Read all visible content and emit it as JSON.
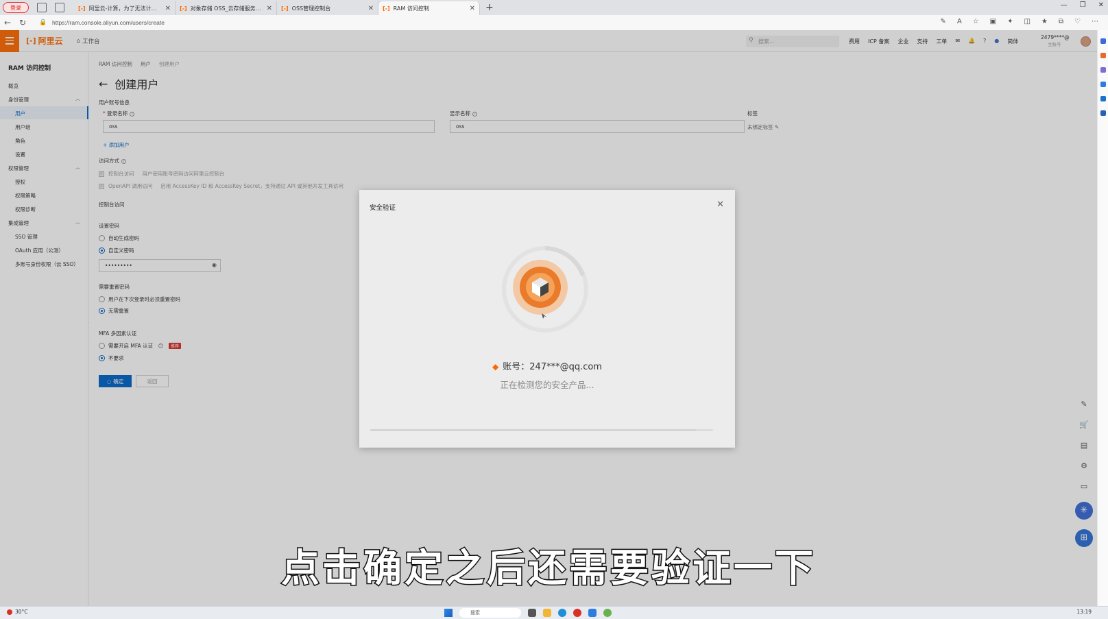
{
  "browser": {
    "profile_label": "登录",
    "tabs": [
      {
        "title": "阿里云-计算，为了无法计算的价",
        "active": false
      },
      {
        "title": "对象存储 OSS_云存储服务_企业",
        "active": false
      },
      {
        "title": "OSS管理控制台",
        "active": false
      },
      {
        "title": "RAM 访问控制",
        "active": true
      }
    ],
    "url": "https://ram.console.aliyun.com/users/create"
  },
  "console_header": {
    "logo_text": "阿里云",
    "workbench_label": "工作台",
    "search_placeholder": "搜索...",
    "links": [
      "费用",
      "ICP 备案",
      "企业",
      "支持",
      "工单",
      "✉",
      "🔔",
      "?",
      "●",
      "简体"
    ],
    "account_id": "2479****@",
    "account_sub": "主账号"
  },
  "sidebar": {
    "title": "RAM 访问控制",
    "overview": "概览",
    "groups": [
      {
        "label": "身份管理",
        "items": [
          "用户",
          "用户组",
          "角色",
          "设置"
        ]
      },
      {
        "label": "权限管理",
        "items": [
          "授权",
          "权限策略",
          "权限诊断"
        ]
      },
      {
        "label": "集成管理",
        "items": [
          "SSO 管理",
          "OAuth 应用（公测）",
          "多账号身份权限（云 SSO）"
        ]
      }
    ],
    "active_item": "用户"
  },
  "page": {
    "breadcrumb": [
      "RAM 访问控制",
      "用户",
      "创建用户"
    ],
    "title": "创建用户",
    "section_account_info": "用户账号信息",
    "login_name_label": "登录名称",
    "login_name_value": "oss",
    "display_name_label": "显示名称",
    "display_name_value": "oss",
    "tag_label": "标签",
    "tag_edit": "未绑定标签",
    "add_user_link": "+ 添加用户",
    "access_mode_label": "访问方式",
    "access_console": "控制台访问",
    "access_console_desc": "用户使用账号密码访问阿里云控制台",
    "access_openapi": "OpenAPI 调用访问",
    "access_openapi_desc": "启用 AccessKey ID 和 AccessKey Secret，支持通过 API 或其他开发工具访问",
    "console_access_section": "控制台访问",
    "set_password_label": "设置密码",
    "pwd_auto": "自动生成密码",
    "pwd_custom": "自定义密码",
    "pwd_value": "•••••••••",
    "reset_pwd_label": "需要重置密码",
    "reset_next_login": "用户在下次登录时必须重置密码",
    "reset_none": "无需重置",
    "mfa_label": "MFA 多因素认证",
    "mfa_required": "需要开启 MFA 认证",
    "mfa_badge": "推荐",
    "mfa_not_required": "不要求",
    "confirm_button": "确定",
    "back_button": "返回"
  },
  "modal": {
    "title": "安全验证",
    "account_line": "账号：247***@qq.com",
    "status_text": "正在检测您的安全产品...",
    "progress": 0.95
  },
  "caption": "点击确定之后还需要验证一下",
  "taskbar": {
    "weather": "30°C",
    "search_placeholder": "搜索",
    "clock": "13:19"
  },
  "colors": {
    "brand": "#ff6a00",
    "primary": "#0064c8",
    "danger": "#d93026"
  }
}
